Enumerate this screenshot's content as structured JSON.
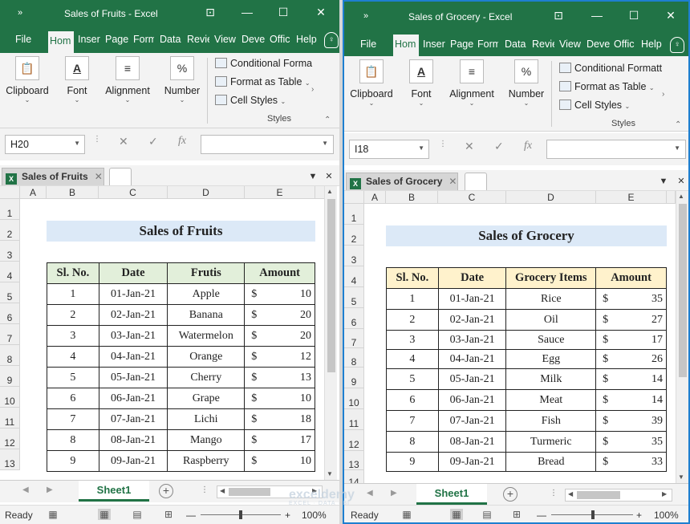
{
  "windows": [
    {
      "title": "Sales of Fruits  -  Excel",
      "tabs": [
        "File",
        "Home",
        "Insert",
        "Page",
        "Formulas",
        "Data",
        "Review",
        "View",
        "Developer",
        "Office",
        "Help"
      ],
      "tab_visible": [
        "File",
        "Hom",
        "Inser",
        "Page",
        "Form",
        "Data",
        "Revie",
        "View",
        "Deve",
        "Offic",
        "Help"
      ],
      "ribbon": {
        "clipboard": "Clipboard",
        "font": "Font",
        "alignment": "Alignment",
        "number": "Number",
        "conditional": "Conditional Forma",
        "format_table": "Format as Table",
        "cell_styles": "Cell Styles",
        "styles": "Styles"
      },
      "name_box": "H20",
      "fx": "fx",
      "workbook_tab": "Sales of Fruits",
      "columns": [
        "A",
        "B",
        "C",
        "D",
        "E"
      ],
      "rows": [
        "1",
        "2",
        "3",
        "4",
        "5",
        "6",
        "7",
        "8",
        "9",
        "10",
        "11",
        "12",
        "13"
      ],
      "heading": "Sales of Fruits",
      "headers": [
        "Sl. No.",
        "Date",
        "Frutis",
        "Amount"
      ],
      "header_color": "#e2efda",
      "data": [
        [
          "1",
          "01-Jan-21",
          "Apple",
          "$",
          "10"
        ],
        [
          "2",
          "02-Jan-21",
          "Banana",
          "$",
          "20"
        ],
        [
          "3",
          "03-Jan-21",
          "Watermelon",
          "$",
          "20"
        ],
        [
          "4",
          "04-Jan-21",
          "Orange",
          "$",
          "12"
        ],
        [
          "5",
          "05-Jan-21",
          "Cherry",
          "$",
          "13"
        ],
        [
          "6",
          "06-Jan-21",
          "Grape",
          "$",
          "10"
        ],
        [
          "7",
          "07-Jan-21",
          "Lichi",
          "$",
          "18"
        ],
        [
          "8",
          "08-Jan-21",
          "Mango",
          "$",
          "17"
        ],
        [
          "9",
          "09-Jan-21",
          "Raspberry",
          "$",
          "10"
        ]
      ],
      "sheet": "Sheet1",
      "status": "Ready",
      "zoom": "100%"
    },
    {
      "title": "Sales of Grocery  -  Excel",
      "tabs": [
        "File",
        "Home",
        "Insert",
        "Page",
        "Formulas",
        "Data",
        "Review",
        "View",
        "Developer",
        "Office",
        "Help"
      ],
      "tab_visible": [
        "File",
        "Hom",
        "Inser",
        "Page",
        "Form",
        "Data",
        "Revie",
        "View",
        "Deve",
        "Offic",
        "Help"
      ],
      "ribbon": {
        "clipboard": "Clipboard",
        "font": "Font",
        "alignment": "Alignment",
        "number": "Number",
        "conditional": "Conditional Formatt",
        "format_table": "Format as Table",
        "cell_styles": "Cell Styles",
        "styles": "Styles"
      },
      "name_box": "I18",
      "fx": "fx",
      "workbook_tab": "Sales of Grocery",
      "columns": [
        "A",
        "B",
        "C",
        "D",
        "E"
      ],
      "rows": [
        "1",
        "2",
        "3",
        "4",
        "5",
        "6",
        "7",
        "8",
        "9",
        "10",
        "11",
        "12",
        "13",
        "14"
      ],
      "heading": "Sales of Grocery",
      "headers": [
        "Sl. No.",
        "Date",
        "Grocery Items",
        "Amount"
      ],
      "header_color": "#fff2cc",
      "data": [
        [
          "1",
          "01-Jan-21",
          "Rice",
          "$",
          "35"
        ],
        [
          "2",
          "02-Jan-21",
          "Oil",
          "$",
          "27"
        ],
        [
          "3",
          "03-Jan-21",
          "Sauce",
          "$",
          "17"
        ],
        [
          "4",
          "04-Jan-21",
          "Egg",
          "$",
          "26"
        ],
        [
          "5",
          "05-Jan-21",
          "Milk",
          "$",
          "14"
        ],
        [
          "6",
          "06-Jan-21",
          "Meat",
          "$",
          "14"
        ],
        [
          "7",
          "07-Jan-21",
          "Fish",
          "$",
          "39"
        ],
        [
          "8",
          "08-Jan-21",
          "Turmeric",
          "$",
          "35"
        ],
        [
          "9",
          "09-Jan-21",
          "Bread",
          "$",
          "33"
        ]
      ],
      "sheet": "Sheet1",
      "status": "Ready",
      "zoom": "100%"
    }
  ],
  "watermark": {
    "name": "exceldemy",
    "tagline": "EXCEL · DATA · BI"
  },
  "colors": {
    "excel_green": "#217346",
    "banner": "#dce9f7",
    "active_border": "#1e7fd0"
  }
}
